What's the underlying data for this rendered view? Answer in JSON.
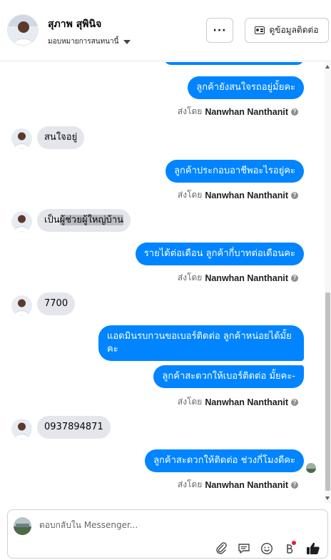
{
  "header": {
    "name": "สุภาพ สุพินิจ",
    "assign_label": "มอบหมายการสนทนานี้",
    "more_label": "···",
    "contact_label": "ดูข้อมูลติดต่อ"
  },
  "messages": [
    {
      "id": "m1",
      "direction": "out",
      "text": "ลูกค้ายังสนใจรถอยู่มั้ยคะ"
    },
    {
      "id": "s1",
      "sent_by_prefix": "ส่งโดย",
      "sent_by_name": "Nanwhan Nanthanit"
    },
    {
      "id": "m2",
      "direction": "in",
      "text": "สนใจอยู่"
    },
    {
      "id": "m3",
      "direction": "out",
      "text": "ลูกค้าประกอบอาชีพอะไรอยู่คะ"
    },
    {
      "id": "s2",
      "sent_by_prefix": "ส่งโดย",
      "sent_by_name": "Nanwhan Nanthanit"
    },
    {
      "id": "m4",
      "direction": "in",
      "text_plain": "เป็น",
      "text_highlight": "ผู้ช่วยผู้ใหญ่บ้าน"
    },
    {
      "id": "m5",
      "direction": "out",
      "text": "รายได้ต่อเดือน ลูกค้ากี่บาทต่อเดือนคะ"
    },
    {
      "id": "s3",
      "sent_by_prefix": "ส่งโดย",
      "sent_by_name": "Nanwhan Nanthanit"
    },
    {
      "id": "m6",
      "direction": "in",
      "text": "7700"
    },
    {
      "id": "m7",
      "direction": "out",
      "text": "แอดมินรบกวนขอเบอร์ติดต่อ ลูกค้าหน่อยได้มั้ยคะ"
    },
    {
      "id": "m8",
      "direction": "out",
      "text": "ลูกค้าสะดวกให้เบอร์ติดต่อ มั้ยคะ-"
    },
    {
      "id": "s4",
      "sent_by_prefix": "ส่งโดย",
      "sent_by_name": "Nanwhan Nanthanit"
    },
    {
      "id": "m9",
      "direction": "in",
      "text": "0937894871"
    },
    {
      "id": "m10",
      "direction": "out",
      "text": "ลูกค้าสะดวกให้ติดต่อ ช่วงกี่โมงดีคะ"
    },
    {
      "id": "s5",
      "sent_by_prefix": "ส่งโดย",
      "sent_by_name": "Nanwhan Nanthanit"
    }
  ],
  "composer": {
    "placeholder": "ตอบกลับใน Messenger..."
  },
  "icons": [
    "more-icon",
    "contact-card-icon",
    "attach-icon",
    "saved-replies-icon",
    "emoji-icon",
    "payment-icon",
    "like-icon"
  ],
  "colors": {
    "outgoing_bubble": "#0084ff",
    "incoming_bubble": "#e4e6eb",
    "like_icon": "#1c1e21",
    "notification_dot": "#e41e3f"
  }
}
